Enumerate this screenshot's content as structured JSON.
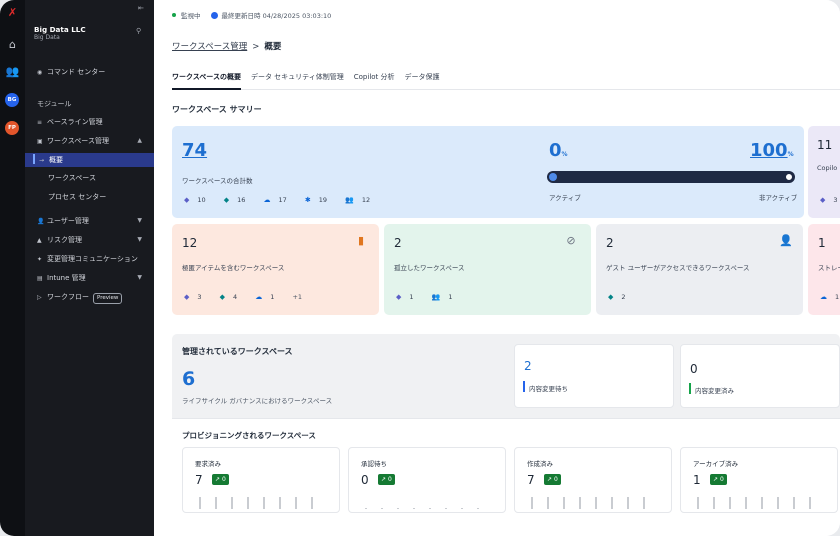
{
  "rail": {
    "badges": [
      {
        "text": "BG",
        "color": "#2563eb"
      },
      {
        "text": "FP",
        "color": "#e2552b"
      }
    ]
  },
  "sidebar": {
    "org_name": "Big Data LLC",
    "org_sub": "Big Data",
    "command_center": "コマンド センター",
    "modules_label": "モジュール",
    "baseline": "ベースライン管理",
    "workspace_mgmt": "ワークスペース管理",
    "overview": "概要",
    "workspaces": "ワークスペース",
    "process_center": "プロセス センター",
    "user_mgmt": "ユーザー管理",
    "risk_mgmt": "リスク管理",
    "change_comm": "変更管理コミュニケーション",
    "intune": "Intune 管理",
    "workflow": "ワークフロー",
    "preview": "Preview"
  },
  "status": {
    "monitoring": "監視中",
    "last_updated": "最終更新日時 04/28/2025 03:03:10"
  },
  "breadcrumb": {
    "parent": "ワークスペース管理",
    "separator": ">",
    "current": "概要"
  },
  "tabs": [
    "ワークスペースの概要",
    "データ セキュリティ体制管理",
    "Copilot 分析",
    "データ保護"
  ],
  "summary": {
    "title": "ワークスペース サマリー",
    "total": "74",
    "total_label": "ワークスペースの合計数",
    "counts": [
      "10",
      "16",
      "17",
      "19",
      "12"
    ],
    "active_pct": "0",
    "inactive_pct": "100",
    "pct_sign": "%",
    "active_label": "アクティブ",
    "inactive_label": "非アクティブ",
    "copilot_num": "11",
    "copilot_label": "Copilo",
    "copilot_count": "3"
  },
  "metric_cards": [
    {
      "num": "12",
      "label": "極匿アイテムを含むワークスペース",
      "stats": [
        "3",
        "4",
        "1",
        "+1"
      ],
      "bg": "#fde8df"
    },
    {
      "num": "2",
      "label": "孤立したワークスペース",
      "stats": [
        "1",
        "1"
      ],
      "bg": "#e3f4ec"
    },
    {
      "num": "2",
      "label": "ゲスト ユーザーがアクセスできるワークスペース",
      "stats": [
        "2"
      ],
      "bg": "#eceef2"
    },
    {
      "num": "1",
      "label": "ストレー",
      "stats": [
        "1"
      ],
      "bg": "#fde6ea"
    }
  ],
  "managed": {
    "title": "管理されているワークスペース",
    "count": "6",
    "label": "ライフサイクル ガバナンスにおけるワークスペース",
    "pending_num": "2",
    "pending_label": "内容変更待ち",
    "done_num": "0",
    "done_label": "内容変更済み"
  },
  "provisioning": {
    "title": "プロビジョニングされるワークスペース",
    "items": [
      {
        "label": "要求済み",
        "count": "7",
        "trend": "0"
      },
      {
        "label": "承認待ち",
        "count": "0",
        "trend": "0"
      },
      {
        "label": "作成済み",
        "count": "7",
        "trend": "0"
      },
      {
        "label": "アーカイブ済み",
        "count": "1",
        "trend": "0"
      }
    ]
  }
}
